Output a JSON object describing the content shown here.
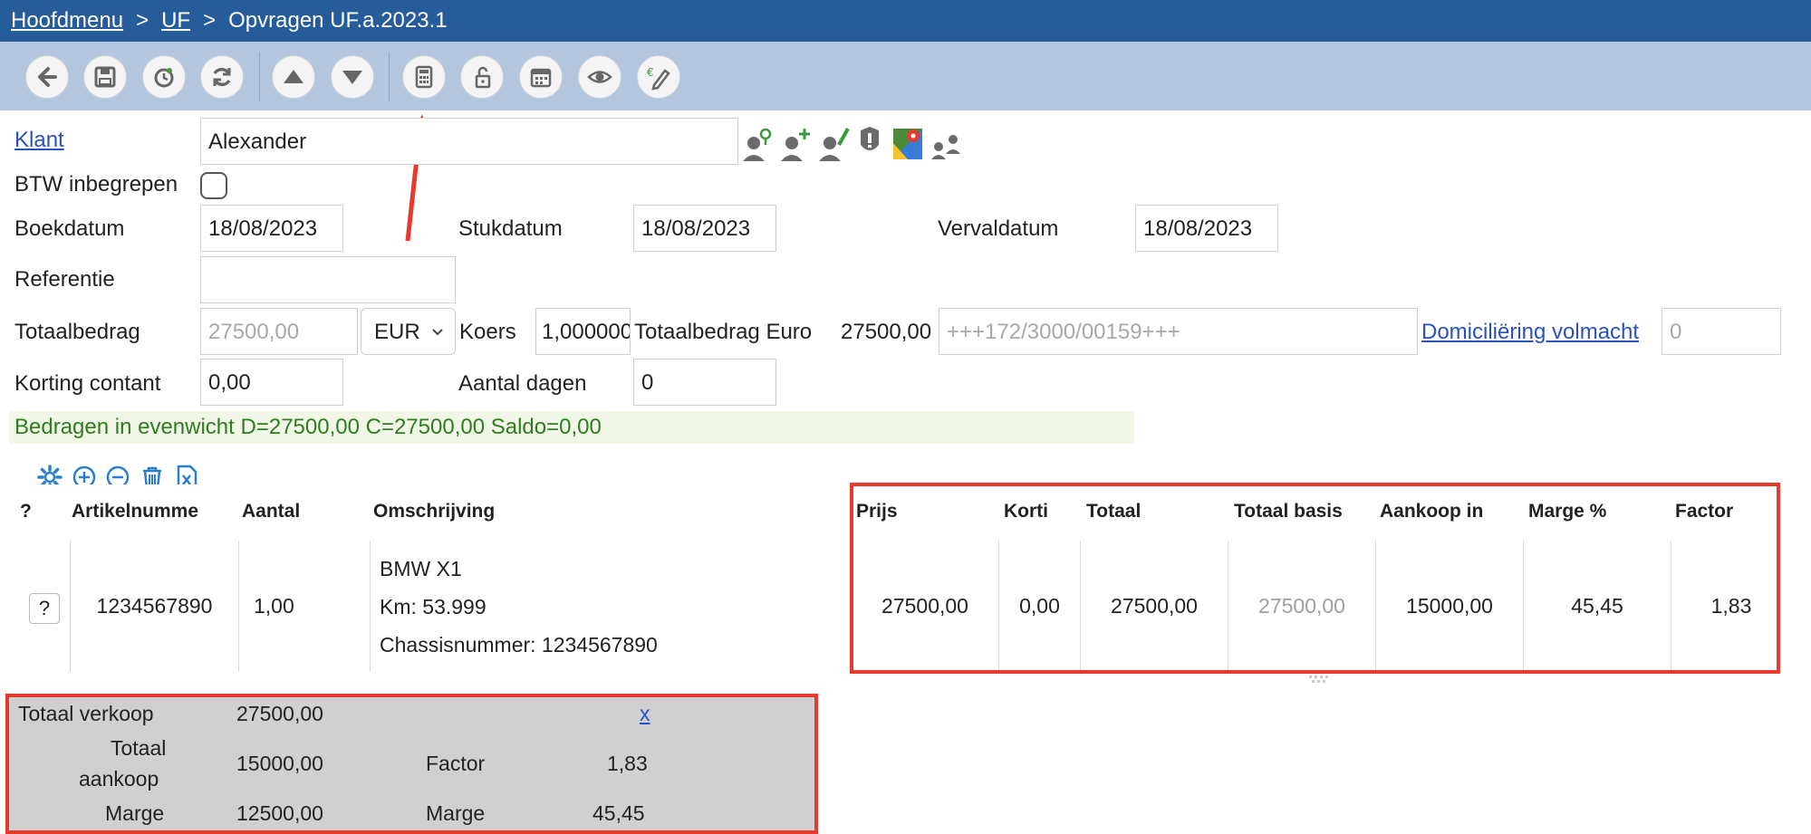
{
  "breadcrumb": {
    "home": "Hoofdmenu",
    "sep1": ">",
    "module": "UF",
    "sep2": ">",
    "current": "Opvragen UF.a.2023.1"
  },
  "toolbar_icons": [
    "back-arrow-icon",
    "save-icon",
    "history-icon",
    "refresh-icon",
    "arrow-up-icon",
    "arrow-down-icon",
    "calculator-icon",
    "unlock-icon",
    "calendar-icon",
    "eye-icon",
    "euro-edit-icon"
  ],
  "form": {
    "klant_label": "Klant",
    "klant_value": "Alexander",
    "btw_label": "BTW inbegrepen",
    "btw_checked": false,
    "boekdatum_label": "Boekdatum",
    "boekdatum_value": "18/08/2023",
    "stukdatum_label": "Stukdatum",
    "stukdatum_value": "18/08/2023",
    "vervaldatum_label": "Vervaldatum",
    "vervaldatum_value": "18/08/2023",
    "referentie_label": "Referentie",
    "referentie_value": "",
    "totaalbedrag_label": "Totaalbedrag",
    "totaalbedrag_value": "27500,00",
    "currency": "EUR",
    "koers_label": "Koers",
    "koers_value": "1,000000",
    "totaalbedrag_euro_label": "Totaalbedrag Euro",
    "totaalbedrag_euro_value": "27500,00",
    "structured_ref": "+++172/3000/00159+++",
    "domiciliering_label": "Domiciliëring volmacht",
    "domiciliering_value": "0",
    "korting_label": "Korting contant",
    "korting_value": "0,00",
    "aantal_dagen_label": "Aantal dagen",
    "aantal_dagen_value": "0"
  },
  "balance_text": "Bedragen in evenwicht D=27500,00 C=27500,00 Saldo=0,00",
  "grid": {
    "headers": {
      "q": "?",
      "artikelnummer": "Artikelnumme",
      "aantal": "Aantal",
      "omschrijving": "Omschrijving",
      "prijs": "Prijs",
      "korting": "Korti",
      "totaal": "Totaal",
      "totaal_basis": "Totaal basis",
      "aankoop": "Aankoop in",
      "marge": "Marge %",
      "factor": "Factor"
    },
    "row": {
      "q_button": "?",
      "artikelnummer": "1234567890",
      "aantal": "1,00",
      "omschrijving_lines": [
        "BMW X1",
        "Km: 53.999",
        "Chassisnummer: 1234567890"
      ],
      "prijs": "27500,00",
      "korting": "0,00",
      "totaal": "27500,00",
      "totaal_basis": "27500,00",
      "aankoop": "15000,00",
      "marge": "45,45",
      "factor": "1,83"
    }
  },
  "totals": {
    "verkoop_label": "Totaal verkoop",
    "verkoop_value": "27500,00",
    "close_link": "x",
    "aankoop_label_1": "Totaal",
    "aankoop_label_2": "aankoop",
    "aankoop_value": "15000,00",
    "factor_label": "Factor",
    "factor_value": "1,83",
    "marge_label": "Marge",
    "marge_value": "12500,00",
    "marge_pct_label": "Marge",
    "marge_pct_value": "45,45"
  },
  "colors": {
    "header_blue": "#255c99",
    "toolbar_bg": "#b4c6dd",
    "annotation_red": "#e8392e",
    "balance_green": "#2f7d1f"
  }
}
